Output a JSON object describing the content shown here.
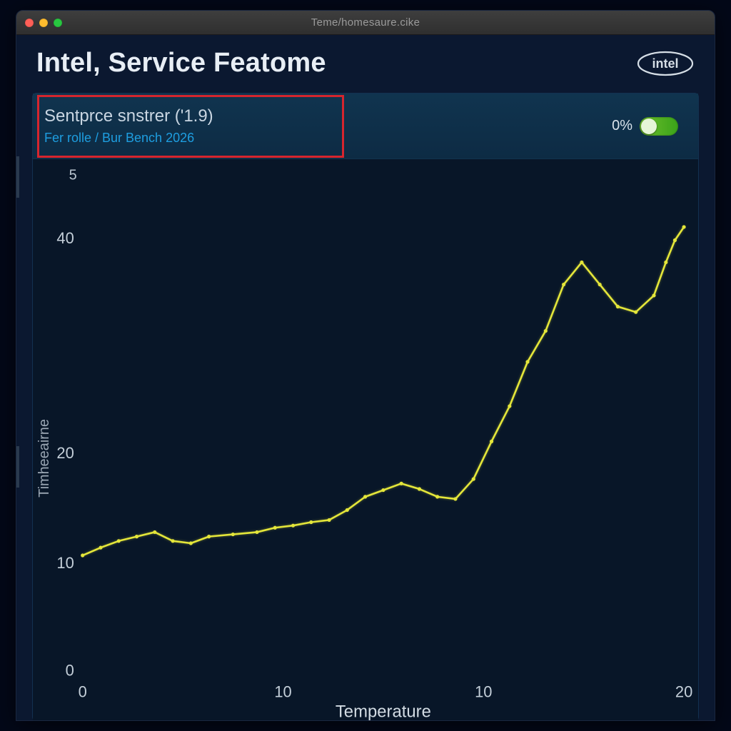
{
  "window": {
    "title": "Teme/homesaure.cike"
  },
  "header": {
    "app_title": "Intel, Service Featome",
    "logo_text": "intel"
  },
  "panel": {
    "title": "Sentprce snstrer ('1.9)",
    "subtitle": "Fer rolle / Bur Bench 2026",
    "percent": "0%",
    "toggle_on": true,
    "y_tick_extra": "5"
  },
  "axes": {
    "xlabel": "Temperature",
    "ylabel": "Timheeairne",
    "x_ticks": [
      "0",
      "10",
      "10",
      "20"
    ],
    "y_ticks": [
      "0",
      "10",
      "20",
      "40"
    ]
  },
  "colors": {
    "bg": "#081628",
    "panel": "#0a2038",
    "line": "#e4e63a",
    "highlight": "#d6252e",
    "accent": "#1e9ee0"
  },
  "chart_data": {
    "type": "line",
    "title": "Sentprce snstrer ('1.9)",
    "xlabel": "Temperature",
    "ylabel": "Timheeairne",
    "xlim": [
      0,
      20
    ],
    "ylim": [
      0,
      45
    ],
    "x": [
      0.0,
      0.6,
      1.2,
      1.8,
      2.4,
      3.0,
      3.6,
      4.2,
      5.0,
      5.8,
      6.4,
      7.0,
      7.6,
      8.2,
      8.8,
      9.4,
      10.0,
      10.6,
      11.2,
      11.8,
      12.4,
      13.0,
      13.6,
      14.2,
      14.8,
      15.4,
      16.0,
      16.6,
      17.2,
      17.8,
      18.4,
      19.0,
      19.4,
      19.7,
      20.0
    ],
    "values": [
      10.5,
      11.2,
      11.8,
      12.2,
      12.6,
      11.8,
      11.6,
      12.2,
      12.4,
      12.6,
      13.0,
      13.2,
      13.5,
      13.7,
      14.6,
      15.8,
      16.4,
      17.0,
      16.5,
      15.8,
      15.6,
      17.4,
      20.8,
      24.0,
      28.0,
      30.8,
      35.0,
      37.0,
      35.0,
      33.0,
      32.5,
      34.0,
      37.0,
      39.0,
      40.2
    ],
    "series": [
      {
        "name": "Sentprce snstrer",
        "color": "#e4e63a"
      }
    ]
  }
}
